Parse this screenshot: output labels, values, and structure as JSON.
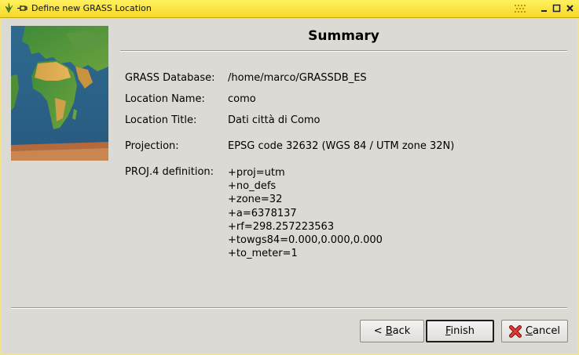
{
  "window": {
    "title": "Define new GRASS Location"
  },
  "page": {
    "heading": "Summary"
  },
  "summary": {
    "database_label": "GRASS Database:",
    "database_value": "/home/marco/GRASSDB_ES",
    "location_name_label": "Location Name:",
    "location_name_value": "como",
    "location_title_label": "Location Title:",
    "location_title_value": "Dati città di Como",
    "projection_label": "Projection:",
    "projection_value": "EPSG code 32632 (WGS 84 / UTM zone 32N)",
    "proj4_label": "PROJ.4 definition:",
    "proj4_lines": [
      "+proj=utm",
      "+no_defs",
      "+zone=32",
      "+a=6378137",
      "+rf=298.257223563",
      "+towgs84=0.000,0.000,0.000",
      "+to_meter=1"
    ]
  },
  "buttons": {
    "back": {
      "pre": "< ",
      "accel": "B",
      "rest": "ack"
    },
    "finish": {
      "accel": "F",
      "rest": "inish"
    },
    "cancel": {
      "accel": "C",
      "rest": "ancel"
    }
  },
  "icons": {
    "app": "grass-app-icon",
    "pin": "pin-icon",
    "minimize": "minimize-icon",
    "maximize": "maximize-icon",
    "close": "close-icon",
    "cancel": "cancel-x-icon",
    "wizard_image": "earth-map-image"
  },
  "colors": {
    "titlebar": "#f6d82a",
    "background": "#dcdad5",
    "cancel_icon": "#d11a1a"
  }
}
